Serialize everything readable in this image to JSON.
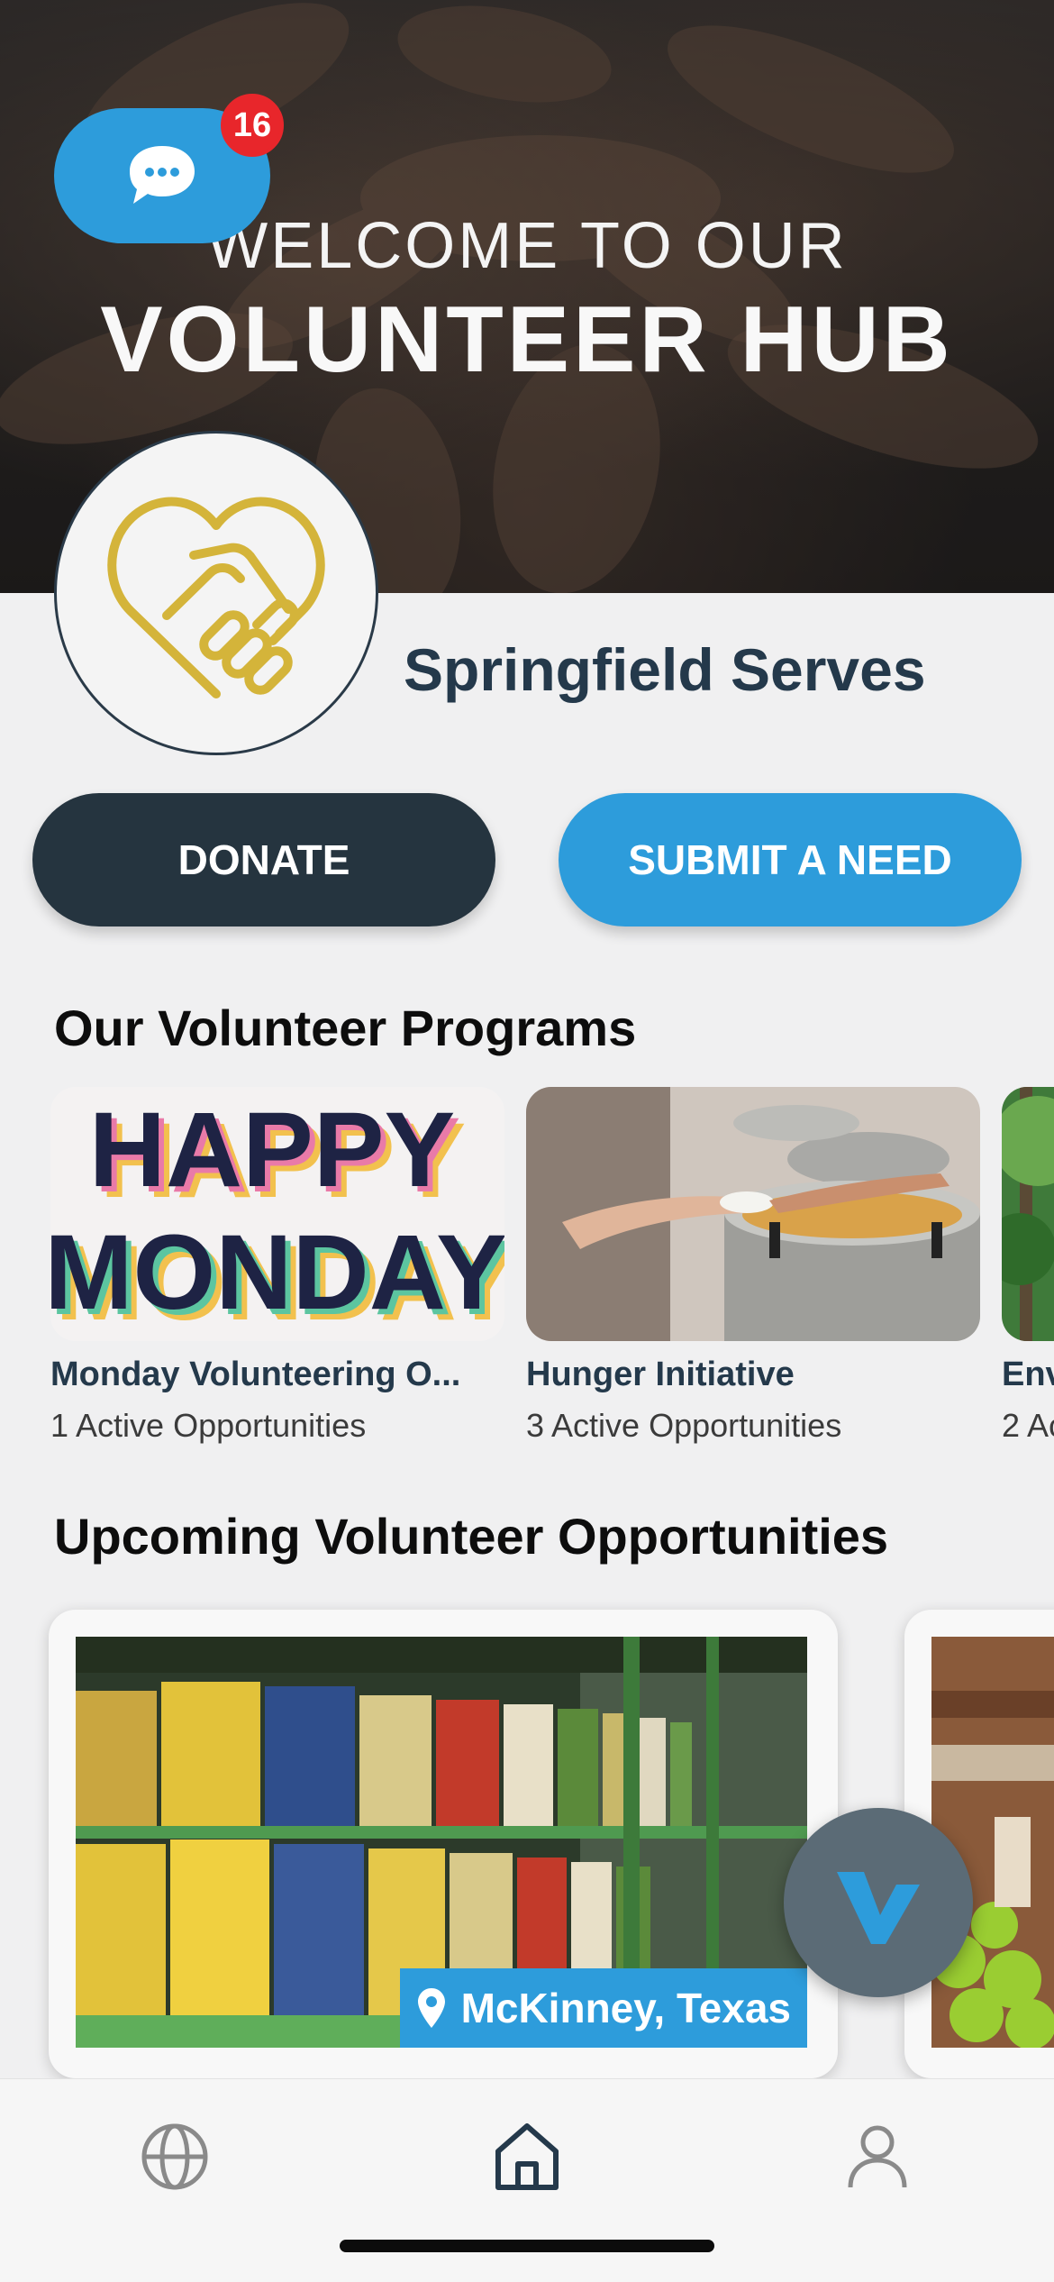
{
  "hero": {
    "line1": "WELCOME TO OUR",
    "line2": "VOLUNTEER HUB"
  },
  "chat": {
    "badge_count": "16",
    "icon": "chat-bubble-icon"
  },
  "organization": {
    "name": "Springfield Serves",
    "logo": "handshake-heart-logo"
  },
  "actions": {
    "donate_label": "DONATE",
    "submit_need_label": "SUBMIT A NEED"
  },
  "programs": {
    "title": "Our Volunteer Programs",
    "items": [
      {
        "title": "Monday Volunteering O...",
        "subtitle": "1 Active Opportunities",
        "image_text": [
          "HAPPY",
          "MONDAY"
        ]
      },
      {
        "title": "Hunger Initiative",
        "subtitle": "3 Active Opportunities"
      },
      {
        "title": "Env",
        "subtitle": "2 Ac"
      }
    ]
  },
  "opportunities": {
    "title": "Upcoming Volunteer Opportunities",
    "items": [
      {
        "location": "McKinney, Texas"
      }
    ]
  },
  "nav": {
    "items": [
      {
        "icon": "globe-icon",
        "active": false
      },
      {
        "icon": "home-icon",
        "active": true
      },
      {
        "icon": "profile-icon",
        "active": false
      }
    ]
  },
  "colors": {
    "accent": "#2d9cdb",
    "dark": "#25343f",
    "badge": "#e8262b",
    "logo_gold": "#d4b43a"
  }
}
